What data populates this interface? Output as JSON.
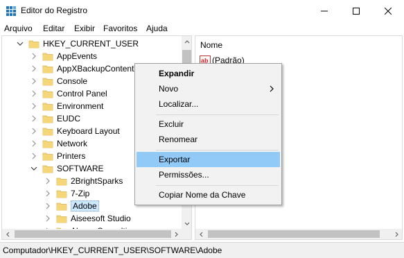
{
  "window": {
    "title": "Editor do Registro"
  },
  "menubar": {
    "items": [
      "Arquivo",
      "Editar",
      "Exibir",
      "Favoritos",
      "Ajuda"
    ]
  },
  "tree": {
    "items": [
      {
        "label": "HKEY_CURRENT_USER",
        "expanded": true,
        "selected": false
      },
      {
        "label": "AppEvents",
        "expanded": false,
        "selected": false
      },
      {
        "label": "AppXBackupContentT",
        "expanded": false,
        "selected": false
      },
      {
        "label": "Console",
        "expanded": false,
        "selected": false
      },
      {
        "label": "Control Panel",
        "expanded": false,
        "selected": false
      },
      {
        "label": "Environment",
        "expanded": false,
        "selected": false
      },
      {
        "label": "EUDC",
        "expanded": false,
        "selected": false
      },
      {
        "label": "Keyboard Layout",
        "expanded": false,
        "selected": false
      },
      {
        "label": "Network",
        "expanded": false,
        "selected": false
      },
      {
        "label": "Printers",
        "expanded": false,
        "selected": false
      },
      {
        "label": "SOFTWARE",
        "expanded": true,
        "selected": false
      },
      {
        "label": "2BrightSparks",
        "expanded": false,
        "selected": false
      },
      {
        "label": "7-Zip",
        "expanded": false,
        "selected": false
      },
      {
        "label": "Adobe",
        "expanded": false,
        "selected": true
      },
      {
        "label": "Aiseesoft Studio",
        "expanded": false,
        "selected": false
      },
      {
        "label": "AlwaysConsulting",
        "expanded": false,
        "selected": false
      }
    ]
  },
  "list": {
    "column_name": "Nome",
    "rows": [
      {
        "name": "(Padrão)",
        "icon": "string-value-icon"
      }
    ]
  },
  "context_menu": {
    "items": [
      {
        "label": "Expandir",
        "bold": true
      },
      {
        "label": "Novo",
        "submenu": true
      },
      {
        "label": "Localizar..."
      },
      {
        "label": "Excluir"
      },
      {
        "label": "Renomear"
      },
      {
        "label": "Exportar",
        "highlighted": true
      },
      {
        "label": "Permissões..."
      },
      {
        "label": "Copiar Nome da Chave"
      }
    ]
  },
  "statusbar": {
    "path": "Computador\\HKEY_CURRENT_USER\\SOFTWARE\\Adobe"
  },
  "colors": {
    "folder": "#f5d77a",
    "selection": "#cce8ff",
    "menu_highlight": "#91c9f7"
  }
}
